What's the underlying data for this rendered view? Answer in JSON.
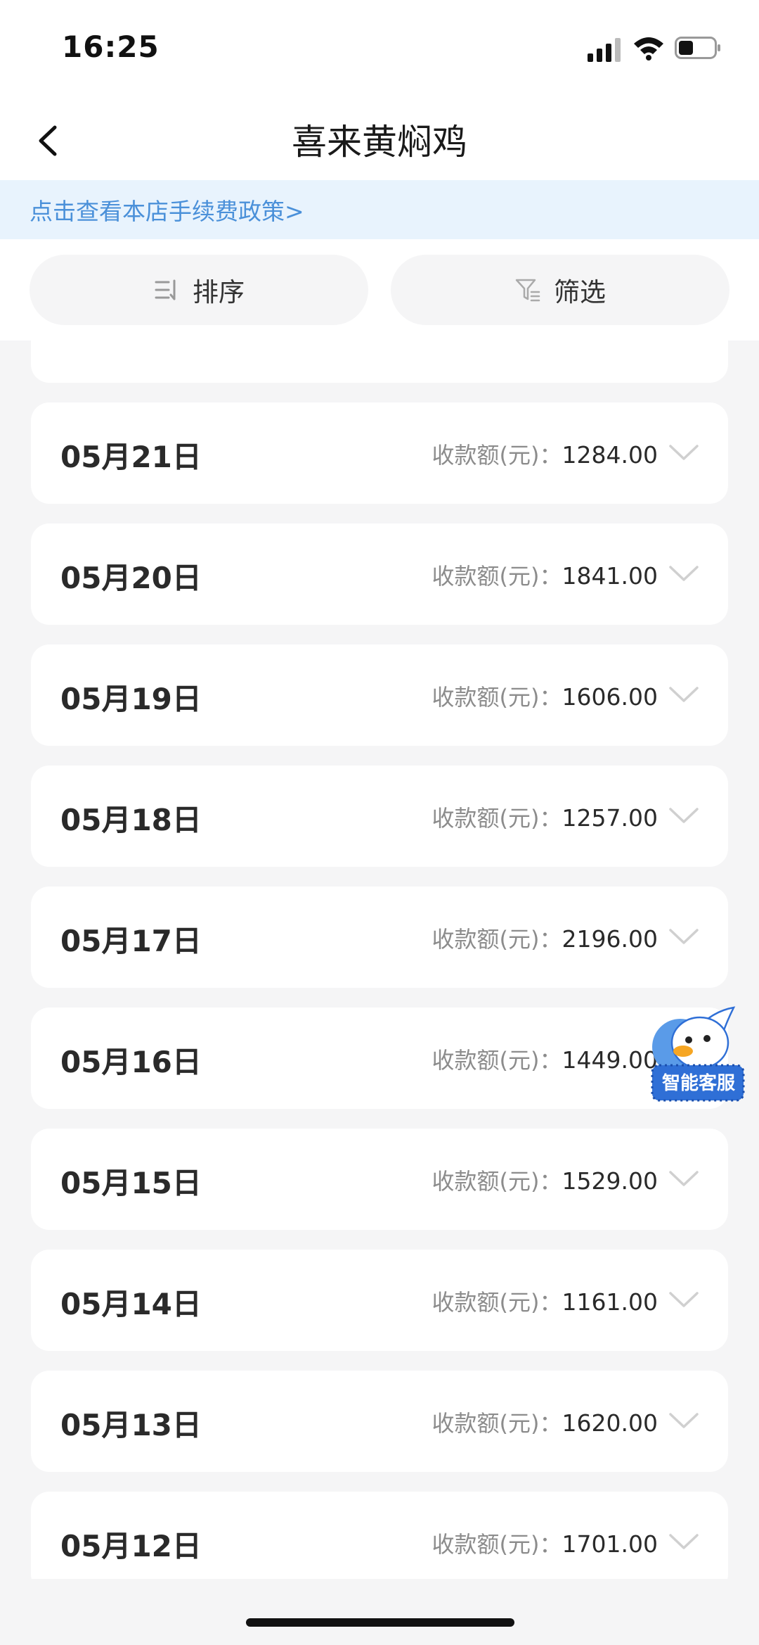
{
  "status_bar": {
    "time": "16:25"
  },
  "header": {
    "title": "喜来黄焖鸡"
  },
  "policy_banner": {
    "text": "点击查看本店手续费政策>"
  },
  "toolbar": {
    "sort_label": "排序",
    "filter_label": "筛选"
  },
  "amount_label": "收款额(元)：",
  "days": [
    {
      "date": "05月21日",
      "amount": "1284.00"
    },
    {
      "date": "05月20日",
      "amount": "1841.00"
    },
    {
      "date": "05月19日",
      "amount": "1606.00"
    },
    {
      "date": "05月18日",
      "amount": "1257.00"
    },
    {
      "date": "05月17日",
      "amount": "2196.00"
    },
    {
      "date": "05月16日",
      "amount": "1449.00"
    },
    {
      "date": "05月15日",
      "amount": "1529.00"
    },
    {
      "date": "05月14日",
      "amount": "1161.00"
    },
    {
      "date": "05月13日",
      "amount": "1620.00"
    },
    {
      "date": "05月12日",
      "amount": "1701.00"
    }
  ],
  "assistant": {
    "label": "智能客服"
  },
  "colors": {
    "accent": "#4a90d9",
    "banner_bg": "#e8f3fd",
    "page_bg": "#f5f5f6"
  }
}
